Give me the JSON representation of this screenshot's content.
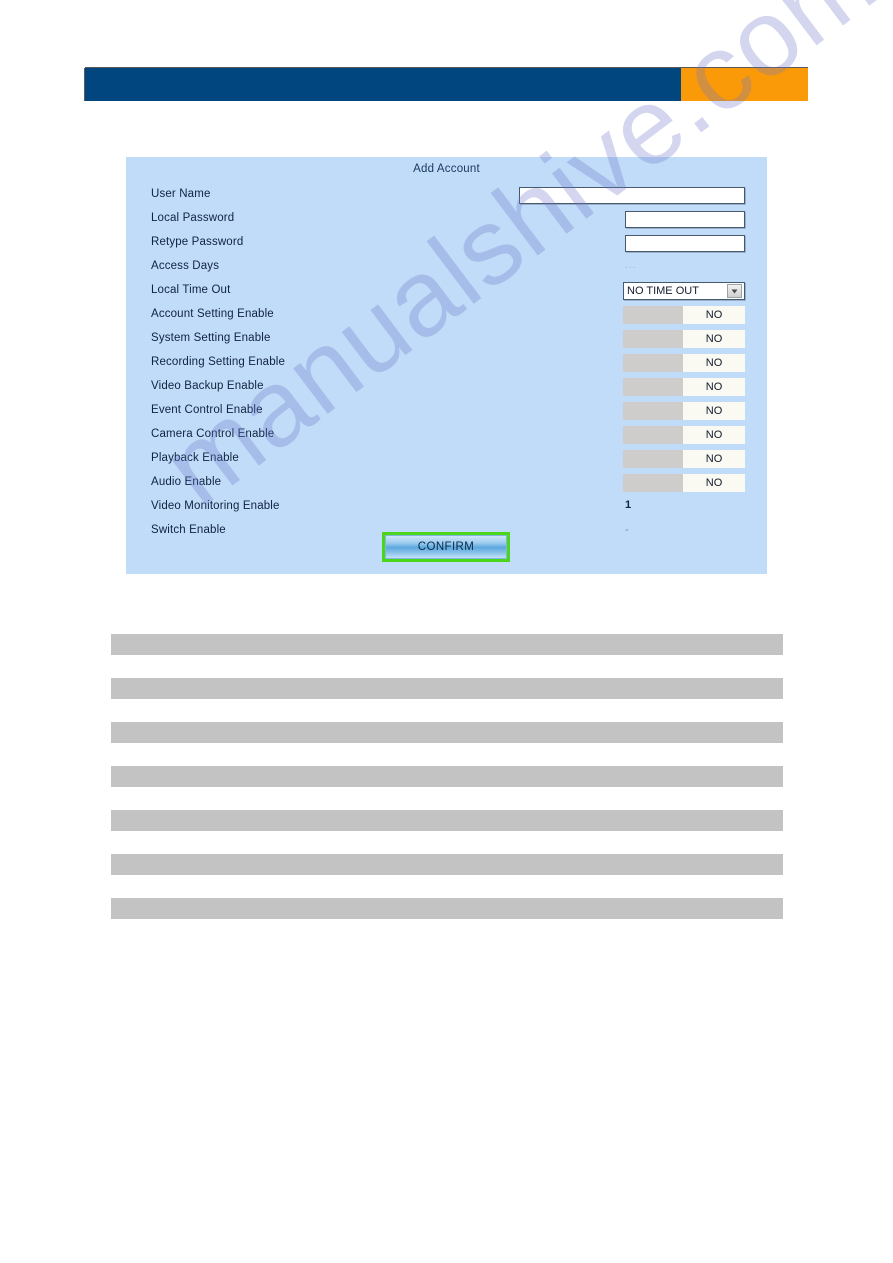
{
  "header": {
    "blue_color": "#02467f",
    "orange_color": "#fb9a08"
  },
  "dialog": {
    "title": "Add Account",
    "panel_color": "#c0dcf8",
    "rows": [
      {
        "label": "User Name",
        "control": "text-wide",
        "value": ""
      },
      {
        "label": "Local Password",
        "control": "text",
        "value": ""
      },
      {
        "label": "Retype Password",
        "control": "text",
        "value": ""
      },
      {
        "label": "Access Days",
        "control": "marker",
        "value": "..."
      },
      {
        "label": "Local Time Out",
        "control": "select",
        "value": "NO TIME OUT"
      },
      {
        "label": "Account Setting Enable",
        "control": "toggle",
        "value": "NO"
      },
      {
        "label": "System Setting Enable",
        "control": "toggle",
        "value": "NO"
      },
      {
        "label": "Recording Setting Enable",
        "control": "toggle",
        "value": "NO"
      },
      {
        "label": "Video Backup Enable",
        "control": "toggle",
        "value": "NO"
      },
      {
        "label": "Event Control Enable",
        "control": "toggle",
        "value": "NO"
      },
      {
        "label": "Camera Control Enable",
        "control": "toggle",
        "value": "NO"
      },
      {
        "label": "Playback Enable",
        "control": "toggle",
        "value": "NO"
      },
      {
        "label": "Audio Enable",
        "control": "toggle",
        "value": "NO"
      },
      {
        "label": "Video Monitoring Enable",
        "control": "value",
        "value": "1"
      },
      {
        "label": "Switch Enable",
        "control": "dash",
        "value": "-"
      }
    ],
    "confirm_label": "CONFIRM",
    "confirm_focus_color": "#4bd61a"
  },
  "placeholder_bars": {
    "count": 7,
    "color": "#c3c3c3"
  },
  "watermark": {
    "text": "manualshive.com"
  }
}
